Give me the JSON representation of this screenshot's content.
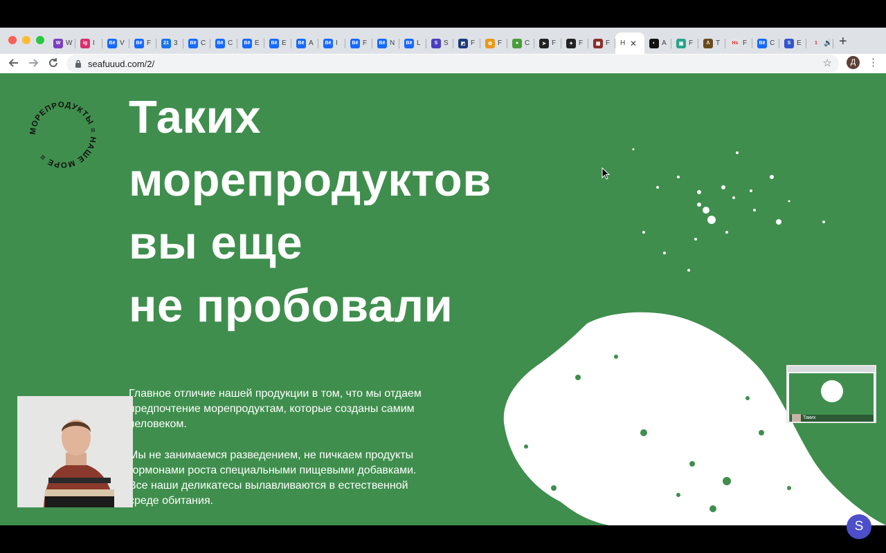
{
  "browser": {
    "tabs": [
      {
        "favicon": "W",
        "color": "#7b3fbf",
        "title": "W"
      },
      {
        "favicon": "ig",
        "color": "#d6306e",
        "title": "I"
      },
      {
        "favicon": "Bē",
        "color": "#1769ff",
        "title": "V"
      },
      {
        "favicon": "Bē",
        "color": "#1769ff",
        "title": "F"
      },
      {
        "favicon": "21",
        "color": "#1a73e8",
        "title": "3"
      },
      {
        "favicon": "Bē",
        "color": "#1769ff",
        "title": "C"
      },
      {
        "favicon": "Bē",
        "color": "#1769ff",
        "title": "C"
      },
      {
        "favicon": "Bē",
        "color": "#1769ff",
        "title": "E"
      },
      {
        "favicon": "Bē",
        "color": "#1769ff",
        "title": "E"
      },
      {
        "favicon": "Bē",
        "color": "#1769ff",
        "title": "A"
      },
      {
        "favicon": "Bē",
        "color": "#1769ff",
        "title": "I"
      },
      {
        "favicon": "Bē",
        "color": "#1769ff",
        "title": "F"
      },
      {
        "favicon": "Bē",
        "color": "#1769ff",
        "title": "N"
      },
      {
        "favicon": "Bē",
        "color": "#1769ff",
        "title": "L"
      },
      {
        "favicon": "S",
        "color": "#4c3fbf",
        "title": "S"
      },
      {
        "favicon": "◩",
        "color": "#1b3a7a",
        "title": "F"
      },
      {
        "favicon": "✿",
        "color": "#e89a1d",
        "title": "F"
      },
      {
        "favicon": "●",
        "color": "#4a9d3a",
        "title": "C"
      },
      {
        "favicon": "➤",
        "color": "#222222",
        "title": "F"
      },
      {
        "favicon": "✦",
        "color": "#222222",
        "title": "F"
      },
      {
        "favicon": "▦",
        "color": "#8a2e2e",
        "title": "F"
      },
      {
        "favicon": "",
        "color": "#ffffff",
        "title": "H",
        "active": true
      },
      {
        "favicon": "◐",
        "color": "#111111",
        "title": "A"
      },
      {
        "favicon": "▣",
        "color": "#2aa38a",
        "title": "F"
      },
      {
        "favicon": "Λ",
        "color": "#6b4a1e",
        "title": "T"
      },
      {
        "favicon": "Hs",
        "color": "#e4e4e4",
        "title": "F"
      },
      {
        "favicon": "Bē",
        "color": "#1769ff",
        "title": "C"
      },
      {
        "favicon": "S",
        "color": "#3355cc",
        "title": "E"
      },
      {
        "favicon": "1",
        "color": "#dee1e6",
        "title": "🔊"
      }
    ],
    "close_glyph": "✕",
    "new_tab_label": "+",
    "url": "seafuuud.com/2/",
    "profile_initial": "Д",
    "icons": [
      "back-icon",
      "forward-icon",
      "reload-icon",
      "lock-icon",
      "star-icon",
      "menu-icon",
      "close-icon"
    ]
  },
  "page": {
    "badge_text": "МОРЕПРОДУКТЫ ≡ НАШЕ МОРЕ ≡ ",
    "heading_lines": [
      "Таких",
      "морепродуктов",
      "вы еще",
      "не пробовали"
    ],
    "paragraph1": "Главное отличие нашей продукции в том, что мы отдаем предпочтение морепродуктам, которые созданы самим человеком.",
    "paragraph2": "Мы не занимаемся разведением, не пичкаем продукты гормонами роста  специальными пищевыми добавками. Все наши деликатесы вылавливаются в естественной среде обитания."
  },
  "overlay": {
    "pip_label": "Таких",
    "avatar_letter": "S"
  },
  "colors": {
    "page_green": "#3f8e4d",
    "splash_white": "#ffffff",
    "avatar_purple": "#4c4fc9",
    "chrome_gray": "#dee1e6"
  }
}
